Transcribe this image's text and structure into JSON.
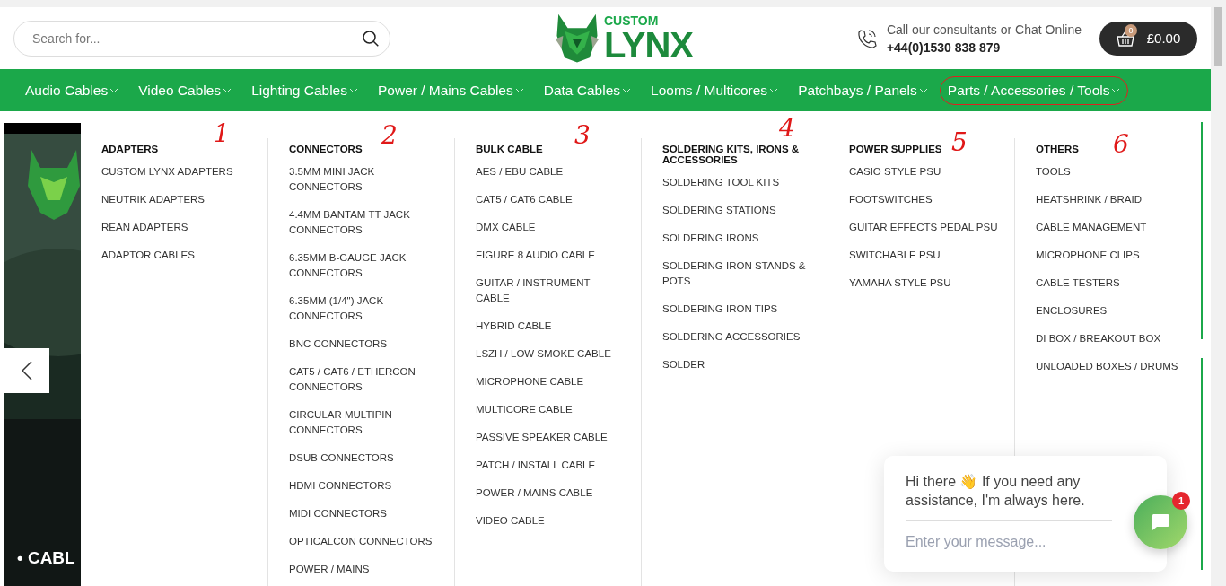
{
  "header": {
    "search": {
      "placeholder": "Search for..."
    },
    "logo": {
      "small": "CUSTOM",
      "big": "LYNX"
    },
    "contact": {
      "line": "Call our consultants or Chat Online",
      "phone": "+44(0)1530 838 879"
    },
    "cart": {
      "count": "0",
      "total": "£0.00"
    }
  },
  "nav": [
    {
      "label": "Audio Cables",
      "selected": false
    },
    {
      "label": "Video Cables",
      "selected": false
    },
    {
      "label": "Lighting Cables",
      "selected": false
    },
    {
      "label": "Power / Mains Cables",
      "selected": false
    },
    {
      "label": "Data Cables",
      "selected": false
    },
    {
      "label": "Looms / Multicores",
      "selected": false
    },
    {
      "label": "Patchbays / Panels",
      "selected": false
    },
    {
      "label": "Parts / Accessories / Tools",
      "selected": true
    }
  ],
  "hero": {
    "caption": "• CABL"
  },
  "menu": [
    {
      "heading": "ADAPTERS",
      "items": [
        "CUSTOM LYNX ADAPTERS",
        "NEUTRIK ADAPTERS",
        "REAN ADAPTERS",
        "ADAPTOR CABLES"
      ]
    },
    {
      "heading": "CONNECTORS",
      "items": [
        "3.5MM MINI JACK CONNECTORS",
        "4.4MM BANTAM TT JACK CONNECTORS",
        "6.35MM B-GAUGE JACK CONNECTORS",
        "6.35MM (1/4\") JACK CONNECTORS",
        "BNC CONNECTORS",
        "CAT5 / CAT6 / ETHERCON CONNECTORS",
        "CIRCULAR MULTIPIN CONNECTORS",
        "DSUB CONNECTORS",
        "HDMI CONNECTORS",
        "MIDI CONNECTORS",
        "OPTICALCON CONNECTORS",
        "POWER / MAINS"
      ]
    },
    {
      "heading": "BULK CABLE",
      "items": [
        "AES / EBU CABLE",
        "CAT5 / CAT6 CABLE",
        "DMX CABLE",
        "FIGURE 8 AUDIO CABLE",
        "GUITAR / INSTRUMENT CABLE",
        "HYBRID CABLE",
        "LSZH / LOW SMOKE CABLE",
        "MICROPHONE CABLE",
        "MULTICORE CABLE",
        "PASSIVE SPEAKER CABLE",
        "PATCH / INSTALL CABLE",
        "POWER / MAINS CABLE",
        "VIDEO CABLE"
      ]
    },
    {
      "heading": "SOLDERING KITS, IRONS & ACCESSORIES",
      "items": [
        "SOLDERING TOOL KITS",
        "SOLDERING STATIONS",
        "SOLDERING IRONS",
        "SOLDERING IRON STANDS & POTS",
        "SOLDERING IRON TIPS",
        "SOLDERING ACCESSORIES",
        "SOLDER"
      ]
    },
    {
      "heading": "POWER SUPPLIES",
      "items": [
        "CASIO STYLE PSU",
        "FOOTSWITCHES",
        "GUITAR EFFECTS PEDAL PSU",
        "SWITCHABLE PSU",
        "YAMAHA STYLE PSU"
      ]
    },
    {
      "heading": "OTHERS",
      "items": [
        "TOOLS",
        "HEATSHRINK / BRAID",
        "CABLE MANAGEMENT",
        "MICROPHONE CLIPS",
        "CABLE TESTERS",
        "ENCLOSURES",
        "DI BOX / BREAKOUT BOX",
        "UNLOADED BOXES / DRUMS"
      ]
    }
  ],
  "annotations": [
    "1",
    "2",
    "3",
    "4",
    "5",
    "6"
  ],
  "chat": {
    "greeting": "Hi there 👋 If you need any assistance, I'm always here.",
    "placeholder": "Enter your message...",
    "badge": "1"
  }
}
